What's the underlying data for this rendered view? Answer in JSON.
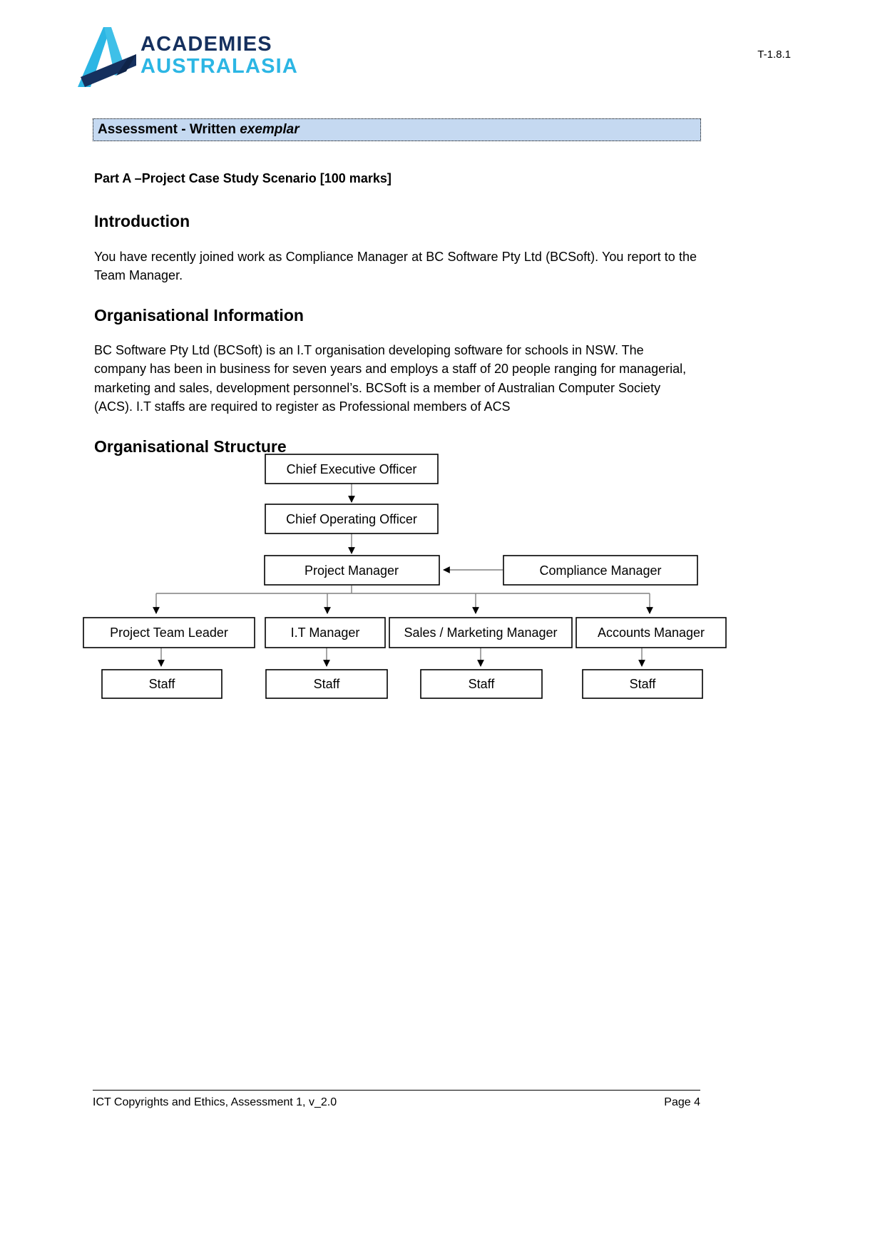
{
  "header": {
    "logo": {
      "line1": "ACADEMIES",
      "line2": "AUSTRALASIA",
      "mark_alt": "academies-australasia-logo",
      "color_dark": "#15305e",
      "color_light": "#2cb6e4"
    },
    "doc_code": "T-1.8.1"
  },
  "title_bar": {
    "text_plain": "Assessment - Written ",
    "text_italic": "exemplar",
    "background": "#c5d9f1"
  },
  "content": {
    "part_heading": "Part A –Project Case Study Scenario [100 marks]",
    "intro_heading": "Introduction",
    "intro_paragraph": "You have recently joined work as Compliance Manager at BC Software Pty Ltd (BCSoft). You report to the Team Manager.",
    "org_info_heading": "Organisational Information",
    "org_info_paragraph": "BC Software Pty Ltd (BCSoft) is an I.T organisation developing software for schools in NSW. The company has been in business for seven years and employs a staff of 20 people ranging for managerial, marketing and sales, development personnel’s. BCSoft is a member of Australian Computer Society (ACS). I.T staffs are required to register as Professional members of ACS",
    "org_structure_heading": "Organisational Structure"
  },
  "org_chart": {
    "nodes": {
      "ceo": "Chief Executive Officer",
      "coo": "Chief Operating Officer",
      "project_manager": "Project Manager",
      "compliance_manager": "Compliance Manager",
      "project_team_leader": "Project Team Leader",
      "it_manager": "I.T Manager",
      "sales_marketing_manager": "Sales / Marketing Manager",
      "accounts_manager": "Accounts Manager",
      "staff_1": "Staff",
      "staff_2": "Staff",
      "staff_3": "Staff",
      "staff_4": "Staff"
    },
    "connector_color": "#808080",
    "box_border_color": "#000000"
  },
  "footer": {
    "left": "ICT Copyrights and Ethics, Assessment 1, v_2.0",
    "right": "Page 4"
  }
}
